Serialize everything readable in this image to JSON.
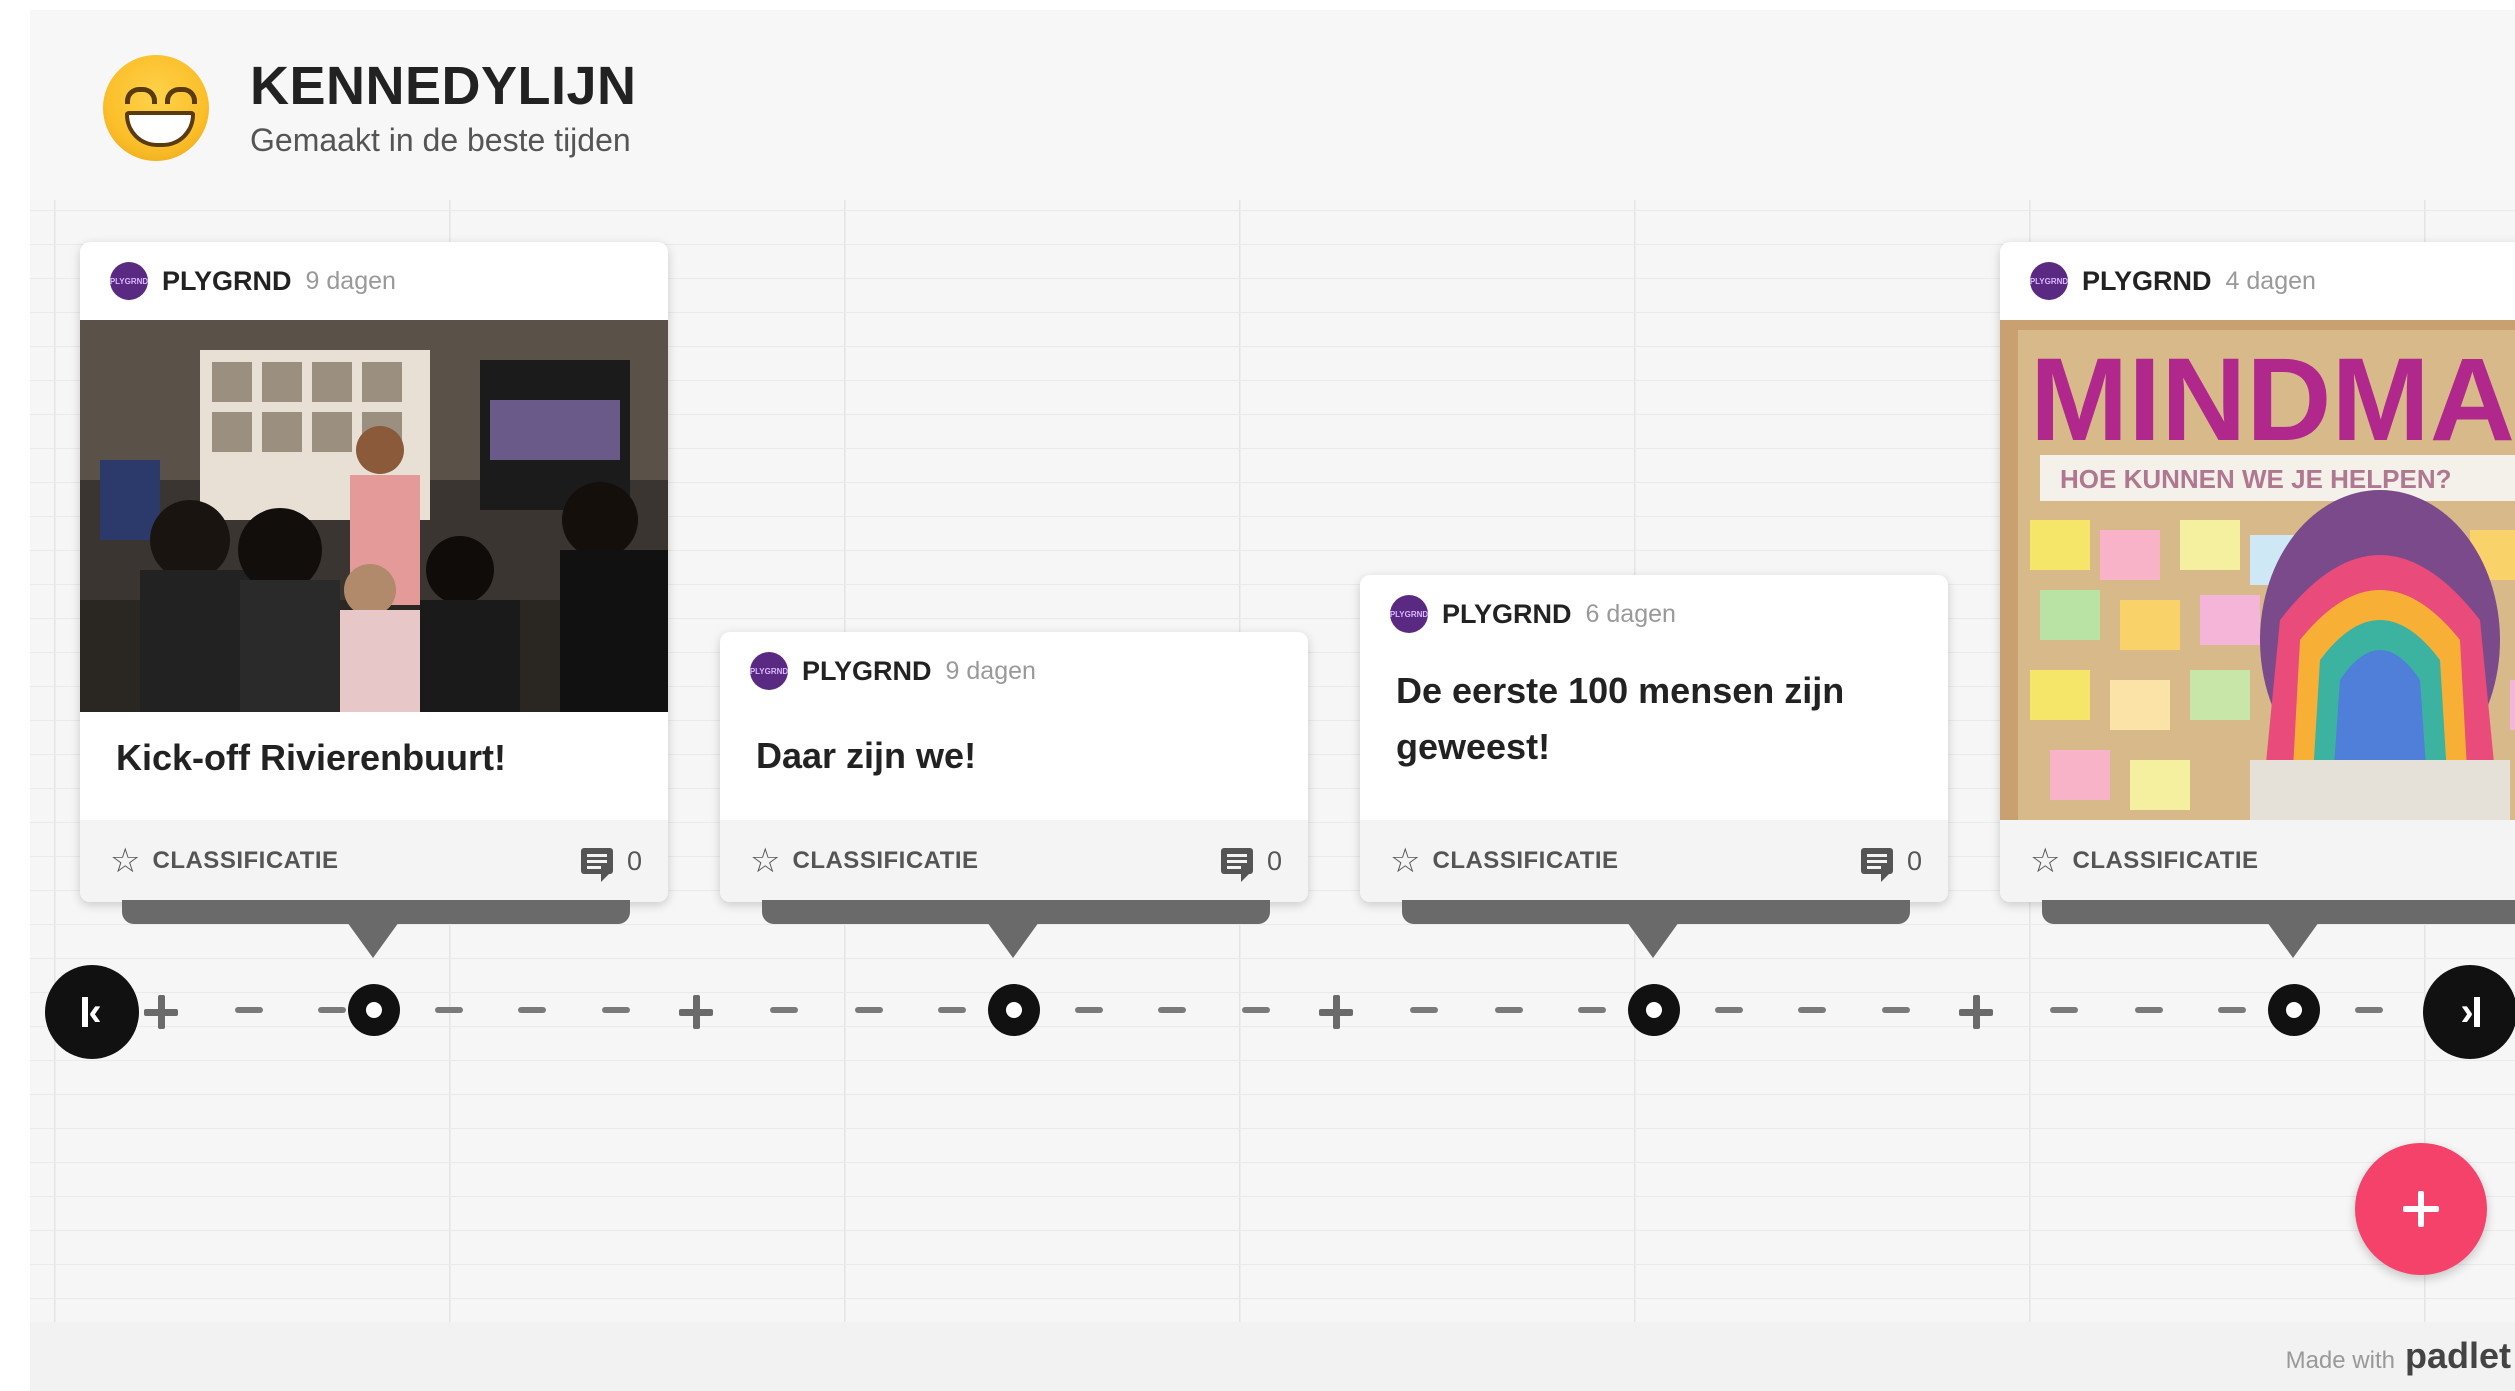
{
  "header": {
    "title": "KENNEDYLIJN",
    "subtitle": "Gemaakt in de beste tijden",
    "emoji_icon": "grinning-face-icon"
  },
  "cards": [
    {
      "author": "PLYGRND",
      "age": "9 dagen",
      "image_description": "photo: group of children in a display room",
      "title": "Kick-off Rivierenbuurt!",
      "classification": "CLASSIFICATIE",
      "comments": "0"
    },
    {
      "author": "PLYGRND",
      "age": "9 dagen",
      "title": "Daar zijn we!",
      "classification": "CLASSIFICATIE",
      "comments": "0"
    },
    {
      "author": "PLYGRND",
      "age": "6 dagen",
      "title": "De eerste 100 mensen zijn geweest!",
      "classification": "CLASSIFICATIE",
      "comments": "0"
    },
    {
      "author": "PLYGRND",
      "age": "4 dagen",
      "image_text": "MINDMAP",
      "image_subtext": "HOE KUNNEN WE JE HELPEN?",
      "classification": "CLASSIFICATIE"
    }
  ],
  "avatar_text": "PLYGRND",
  "footer": {
    "made_with": "Made with",
    "brand": "padlet"
  },
  "colors": {
    "fab": "#f4426a",
    "avatar": "#5a2a82",
    "timeline": "#111111"
  }
}
